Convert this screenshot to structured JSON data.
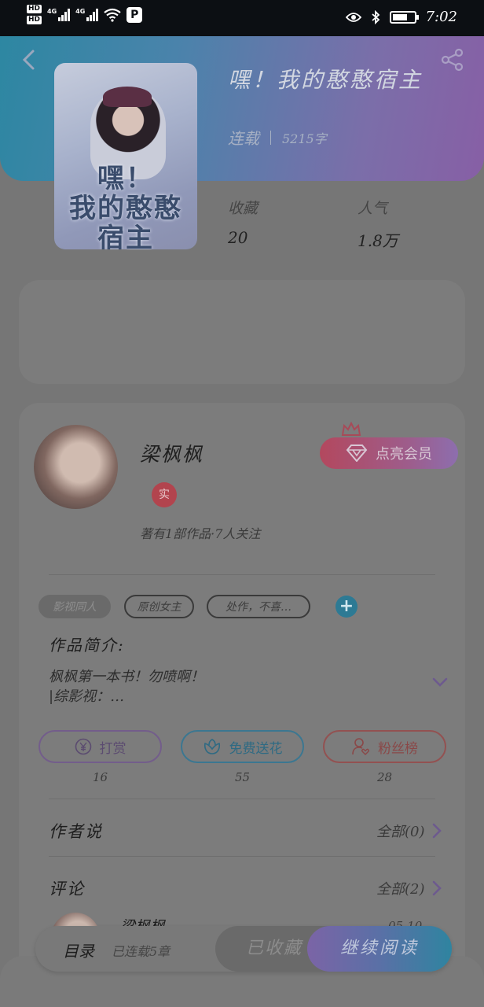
{
  "status_bar": {
    "hd1": "HD",
    "hd2": "HD",
    "net1": "4G",
    "net2": "4G",
    "p_badge": "P",
    "time": "7:02"
  },
  "book": {
    "title": "嘿！我的憨憨宿主",
    "cover_text_line1": "嘿！",
    "cover_text_line2": "我的憨憨",
    "cover_text_line3": "宿主",
    "status": "连载",
    "word_count": "5215字",
    "stats": [
      {
        "label": "收藏",
        "value": "20"
      },
      {
        "label": "人气",
        "value": "1.8万"
      }
    ]
  },
  "author": {
    "name": "梁枫枫",
    "verify_badge": "实",
    "summary": "著有1部作品·7人关注",
    "vip_button": "点亮会员"
  },
  "tags": [
    "影视同人",
    "原创女主",
    "处作，不喜…"
  ],
  "add_tag": "+",
  "intro": {
    "title": "作品简介:",
    "line1": "枫枫第一本书！勿喷啊！",
    "line2": "|综影视：…"
  },
  "actions": [
    {
      "label": "打赏",
      "count": "16",
      "icon": "yen-coin-icon"
    },
    {
      "label": "免费送花",
      "count": "55",
      "icon": "flower-icon"
    },
    {
      "label": "粉丝榜",
      "count": "28",
      "icon": "fan-user-icon"
    }
  ],
  "sections": {
    "author_says": {
      "title": "作者说",
      "more": "全部(0)"
    },
    "comments": {
      "title": "评论",
      "more": "全部(2)"
    }
  },
  "comment": {
    "name": "梁枫枫",
    "date": "05-10"
  },
  "bottom_bar": {
    "toc": "目录",
    "toc_sub": "已连载5章",
    "collected": "已收藏",
    "continue": "继续阅读"
  },
  "colors": {
    "accent_teal": "#2f84a0",
    "accent_purple": "#7b64a6",
    "vip_red": "#b3485e"
  }
}
